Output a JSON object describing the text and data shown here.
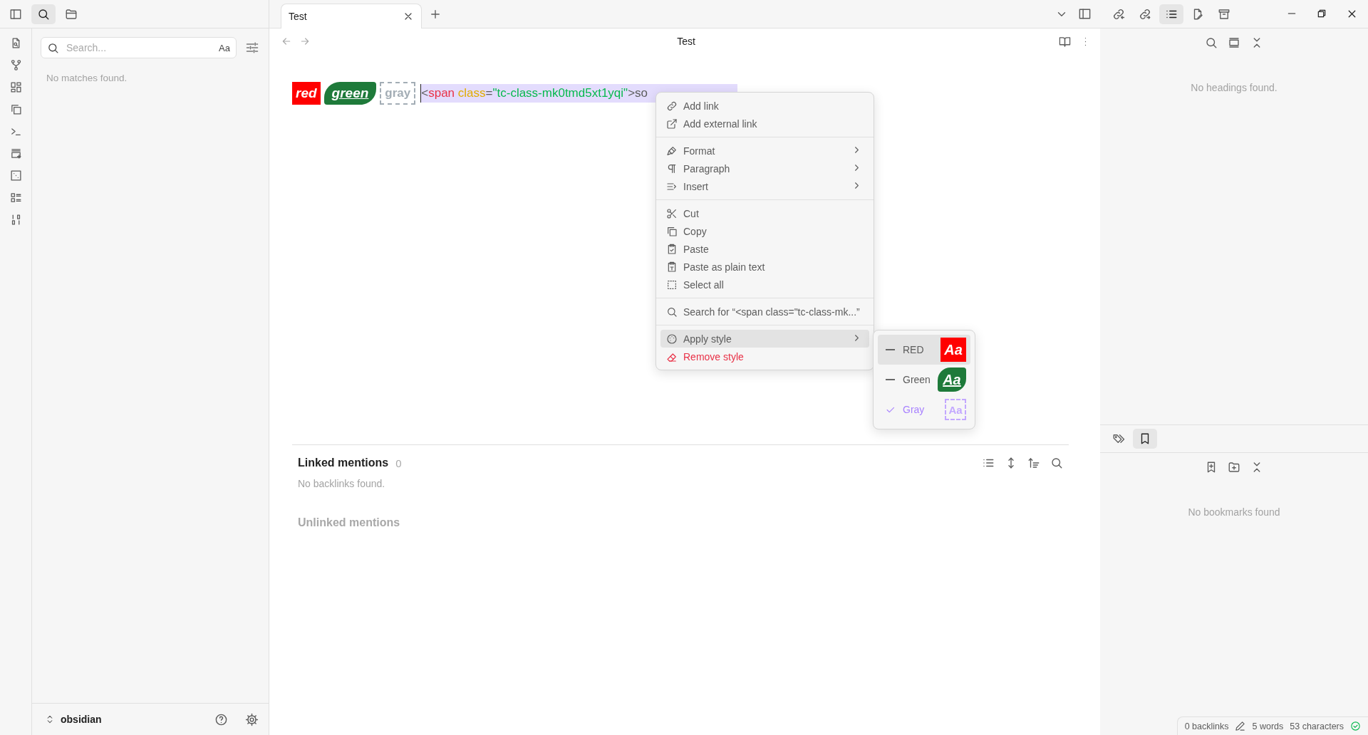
{
  "left_sidebar": {
    "tabs": [
      {
        "kind": "search",
        "selected": true
      },
      {
        "kind": "files",
        "selected": false
      }
    ],
    "search": {
      "placeholder": "Search...",
      "match_case": "Aa"
    },
    "message": "No matches found.",
    "vault": "obsidian"
  },
  "tabs": [
    {
      "label": "Test",
      "selected": true
    }
  ],
  "view": {
    "title": "Test"
  },
  "editor": {
    "chips": [
      {
        "kind": "red",
        "text": "red"
      },
      {
        "kind": "green",
        "text": "green"
      },
      {
        "kind": "gray",
        "text": "gray"
      }
    ],
    "code": {
      "selected": true,
      "segments": [
        {
          "kind": "punct",
          "text": "<"
        },
        {
          "kind": "tag",
          "text": "span"
        },
        {
          "kind": "attr",
          "text": " class"
        },
        {
          "kind": "punct",
          "text": "="
        },
        {
          "kind": "string",
          "text": "\"tc-class-mk0tmd5xt1yqi\""
        },
        {
          "kind": "punct",
          "text": ">so"
        }
      ]
    }
  },
  "context_menu": {
    "groups": [
      [
        {
          "label": "Add link",
          "submenu": false,
          "selected": false,
          "danger": false
        },
        {
          "label": "Add external link",
          "submenu": false,
          "selected": false,
          "danger": false
        }
      ],
      [
        {
          "label": "Format",
          "submenu": true,
          "selected": false,
          "danger": false
        },
        {
          "label": "Paragraph",
          "submenu": true,
          "selected": false,
          "danger": false
        },
        {
          "label": "Insert",
          "submenu": true,
          "selected": false,
          "danger": false
        }
      ],
      [
        {
          "label": "Cut",
          "submenu": false,
          "selected": false,
          "danger": false
        },
        {
          "label": "Copy",
          "submenu": false,
          "selected": false,
          "danger": false
        },
        {
          "label": "Paste",
          "submenu": false,
          "selected": false,
          "danger": false
        },
        {
          "label": "Paste as plain text",
          "submenu": false,
          "selected": false,
          "danger": false
        },
        {
          "label": "Select all",
          "submenu": false,
          "selected": false,
          "danger": false
        }
      ],
      [
        {
          "label": "Search for “<span class=\"tc-class-mk...”",
          "submenu": false,
          "selected": false,
          "danger": false
        }
      ],
      [
        {
          "label": "Apply style",
          "submenu": true,
          "selected": true,
          "danger": false
        },
        {
          "label": "Remove style",
          "submenu": false,
          "selected": false,
          "danger": true
        }
      ]
    ]
  },
  "style_submenu": {
    "items": [
      {
        "label": "RED",
        "kind": "red",
        "preview": "Aa",
        "checked": false,
        "selected": true
      },
      {
        "label": "Green",
        "kind": "green",
        "preview": "Aa",
        "checked": false,
        "selected": false
      },
      {
        "label": "Gray",
        "kind": "gray",
        "preview": "Aa",
        "checked": true,
        "selected": false
      }
    ]
  },
  "backlinks": {
    "title": "Linked mentions",
    "count": "0",
    "empty": "No backlinks found.",
    "unlinked": "Unlinked mentions"
  },
  "right_sidebar": {
    "tabs": [
      {
        "kind": "backlinks",
        "selected": false
      },
      {
        "kind": "outgoing",
        "selected": false
      },
      {
        "kind": "outline",
        "selected": true
      },
      {
        "kind": "note",
        "selected": false
      },
      {
        "kind": "archive",
        "selected": false
      }
    ],
    "outline_message": "No headings found.",
    "lower_tabs": [
      {
        "kind": "tags",
        "selected": false
      },
      {
        "kind": "bookmarks",
        "selected": true
      }
    ],
    "bookmarks_message": "No bookmarks found"
  },
  "status_bar": {
    "backlinks": "0 backlinks",
    "words": "5 words",
    "characters": "53 characters"
  }
}
